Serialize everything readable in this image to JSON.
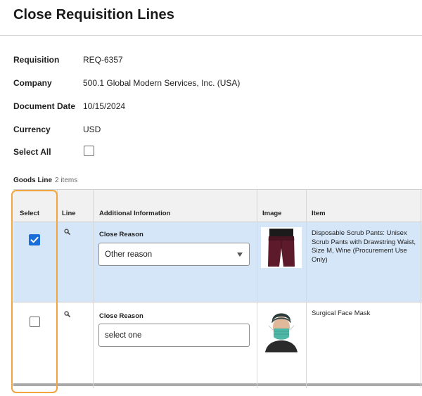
{
  "title": "Close Requisition Lines",
  "fields": {
    "requisition": {
      "label": "Requisition",
      "value": "REQ-6357"
    },
    "company": {
      "label": "Company",
      "value": "500.1 Global Modern Services, Inc. (USA)"
    },
    "document_date": {
      "label": "Document Date",
      "value": "10/15/2024"
    },
    "currency": {
      "label": "Currency",
      "value": "USD"
    },
    "select_all": {
      "label": "Select All",
      "checked": false
    }
  },
  "goods": {
    "label": "Goods Line",
    "count": "2 items",
    "columns": [
      "Select",
      "Line",
      "Additional Information",
      "Image",
      "Item"
    ],
    "rows": [
      {
        "selected": true,
        "reason_label": "Close Reason",
        "reason_value": "Other reason",
        "item": "Disposable Scrub Pants: Unisex Scrub Pants with Drawstring Waist, Size M, Wine (Procurement Use Only)",
        "image": "scrub-pants-image"
      },
      {
        "selected": false,
        "reason_label": "Close Reason",
        "reason_value": "select one",
        "item": "Surgical Face Mask",
        "image": "face-mask-image"
      }
    ]
  },
  "colors": {
    "selected_row": "#d4e6f8",
    "checkbox_checked": "#1a6ed8",
    "highlight": "#f0a53e"
  }
}
